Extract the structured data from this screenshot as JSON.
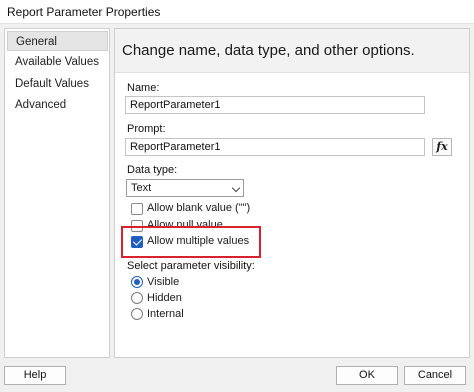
{
  "window": {
    "title": "Report Parameter Properties"
  },
  "nav": {
    "items": [
      "General",
      "Available Values",
      "Default Values",
      "Advanced"
    ],
    "selected": "General"
  },
  "content": {
    "heading": "Change name, data type, and other options.",
    "name": {
      "label": "Name:",
      "value": "ReportParameter1"
    },
    "prompt": {
      "label": "Prompt:",
      "value": "ReportParameter1",
      "expression_button": "fx"
    },
    "data_type": {
      "label": "Data type:",
      "value": "Text"
    },
    "options": [
      {
        "label": "Allow blank value (\"\")",
        "checked": false
      },
      {
        "label": "Allow null value",
        "checked": false
      },
      {
        "label": "Allow multiple values",
        "checked": true
      }
    ],
    "visibility": {
      "label": "Select parameter visibility:",
      "options": [
        {
          "label": "Visible",
          "selected": true
        },
        {
          "label": "Hidden",
          "selected": false
        },
        {
          "label": "Internal",
          "selected": false
        }
      ]
    }
  },
  "footer": {
    "help": "Help",
    "ok": "OK",
    "cancel": "Cancel"
  },
  "colors": {
    "accent": "#1f5fbf",
    "highlight_box": "#d7232f"
  }
}
